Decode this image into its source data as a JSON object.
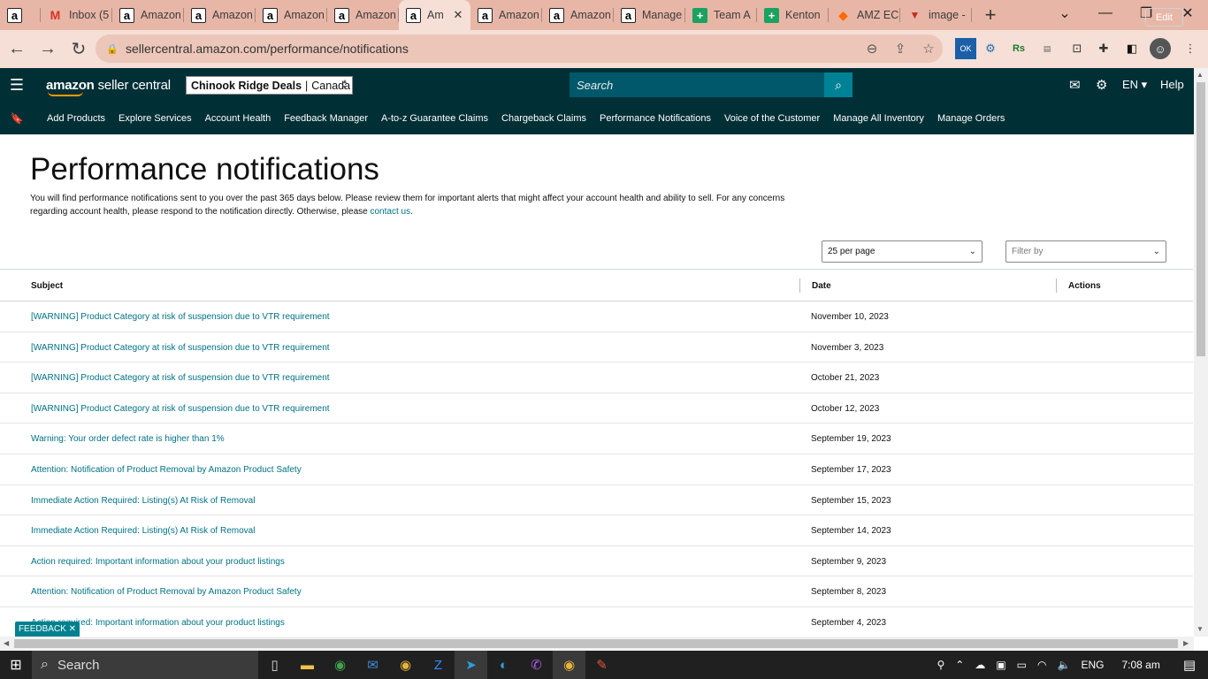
{
  "browser": {
    "tabs": [
      {
        "icon": "amazon-icon",
        "label": "",
        "kind": "amz"
      },
      {
        "icon": "gmail-icon",
        "label": "Inbox (5",
        "kind": "gmail"
      },
      {
        "icon": "amazon-icon",
        "label": "Amazon",
        "kind": "amz"
      },
      {
        "icon": "amazon-icon",
        "label": "Amazon",
        "kind": "amz"
      },
      {
        "icon": "amazon-icon",
        "label": "Amazon",
        "kind": "amz"
      },
      {
        "icon": "amazon-icon",
        "label": "Amazon",
        "kind": "amz"
      },
      {
        "icon": "amazon-icon",
        "label": "Am",
        "kind": "amz",
        "active": true
      },
      {
        "icon": "amazon-icon",
        "label": "Amazon",
        "kind": "amz"
      },
      {
        "icon": "amazon-icon",
        "label": "Amazon",
        "kind": "amz"
      },
      {
        "icon": "amazon-icon",
        "label": "Manage",
        "kind": "amz"
      },
      {
        "icon": "sheets-icon",
        "label": "Team A",
        "kind": "sheets"
      },
      {
        "icon": "sheets-icon",
        "label": "Kenton",
        "kind": "sheets"
      },
      {
        "icon": "amz-ecom-icon",
        "label": "AMZ EC",
        "kind": "amzec"
      },
      {
        "icon": "image-icon",
        "label": "image -",
        "kind": "img"
      }
    ],
    "url": "sellercentral.amazon.com/performance/notifications"
  },
  "header": {
    "logo_brand": "amazon",
    "logo_product": " seller central",
    "account_name": "Chinook Ridge Deals",
    "account_region": "Canada",
    "search_placeholder": "Search",
    "language": "EN",
    "help": "Help"
  },
  "nav": {
    "links": [
      "Add Products",
      "Explore Services",
      "Account Health",
      "Feedback Manager",
      "A-to-z Guarantee Claims",
      "Chargeback Claims",
      "Performance Notifications",
      "Voice of the Customer",
      "Manage All Inventory",
      "Manage Orders"
    ],
    "edit": "Edit"
  },
  "page": {
    "title": "Performance notifications",
    "description": "You will find performance notifications sent to you over the past 365 days below. Please review them for important alerts that might affect your account health and ability to sell. For any concerns regarding account health, please respond to the notification directly. Otherwise, please ",
    "contact_link": "contact us",
    "description_end": ".",
    "per_page": "25 per page",
    "filter_placeholder": "Filter by"
  },
  "table": {
    "columns": [
      "Subject",
      "Date",
      "Actions"
    ],
    "rows": [
      {
        "subject": "[WARNING] Product Category at risk of suspension due to VTR requirement",
        "date": "November 10, 2023"
      },
      {
        "subject": "[WARNING] Product Category at risk of suspension due to VTR requirement",
        "date": "November 3, 2023"
      },
      {
        "subject": "[WARNING] Product Category at risk of suspension due to VTR requirement",
        "date": "October 21, 2023"
      },
      {
        "subject": "[WARNING] Product Category at risk of suspension due to VTR requirement",
        "date": "October 12, 2023"
      },
      {
        "subject": "Warning: Your order defect rate is higher than 1%",
        "date": "September 19, 2023"
      },
      {
        "subject": "Attention: Notification of Product Removal by Amazon Product Safety",
        "date": "September 17, 2023"
      },
      {
        "subject": "Immediate Action Required: Listing(s) At Risk of Removal",
        "date": "September 15, 2023"
      },
      {
        "subject": "Immediate Action Required: Listing(s) At Risk of Removal",
        "date": "September 14, 2023"
      },
      {
        "subject": "Action required: Important information about your product listings",
        "date": "September 9, 2023"
      },
      {
        "subject": "Attention: Notification of Product Removal by Amazon Product Safety",
        "date": "September 8, 2023"
      },
      {
        "subject": "Action required: Important information about your product listings",
        "date": "September 4, 2023"
      }
    ]
  },
  "feedback": "FEEDBACK",
  "taskbar": {
    "search": "Search",
    "language": "ENG",
    "time": "7:08 am"
  },
  "colors": {
    "header_bg": "#002f36",
    "link": "#007185",
    "search_btn": "#008296",
    "tabstrip": "#e8b6a6"
  }
}
